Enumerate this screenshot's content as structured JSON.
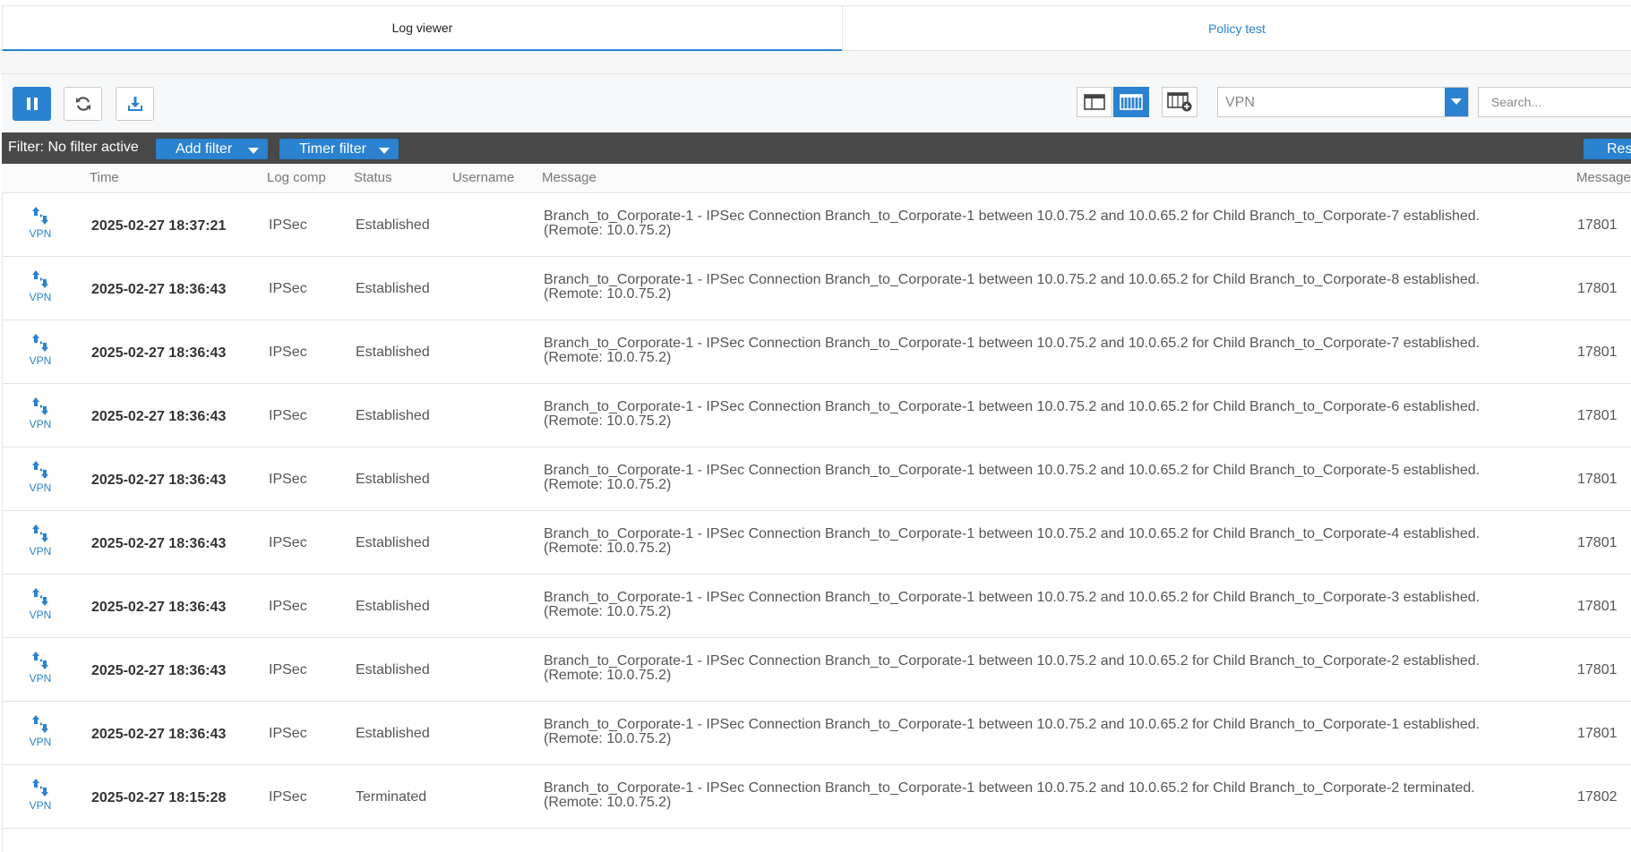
{
  "tabs": [
    {
      "label": "Log viewer",
      "active": true
    },
    {
      "label": "Policy test",
      "active": false
    }
  ],
  "toolbar": {
    "pause_icon": "pause-icon",
    "refresh_icon": "refresh-icon",
    "export_icon": "download-icon",
    "module_select": {
      "value": "VPN"
    },
    "search": {
      "placeholder": "Search..."
    }
  },
  "filterbar": {
    "label": "Filter: No filter active",
    "add_filter": "Add filter",
    "timer_filter": "Timer filter",
    "reset": "Res"
  },
  "columns": [
    "Time",
    "Log comp",
    "Status",
    "Username",
    "Message",
    "Message"
  ],
  "rows": [
    {
      "icon_label": "VPN",
      "time": "2025-02-27 18:37:21",
      "comp": "IPSec",
      "status": "Established",
      "username": "",
      "msg1": "Branch_to_Corporate-1 - IPSec Connection Branch_to_Corporate-1 between 10.0.75.2 and 10.0.65.2 for Child Branch_to_Corporate-7 established.",
      "msg2": "(Remote: 10.0.75.2)",
      "msgid": "17801"
    },
    {
      "icon_label": "VPN",
      "time": "2025-02-27 18:36:43",
      "comp": "IPSec",
      "status": "Established",
      "username": "",
      "msg1": "Branch_to_Corporate-1 - IPSec Connection Branch_to_Corporate-1 between 10.0.75.2 and 10.0.65.2 for Child Branch_to_Corporate-8 established.",
      "msg2": "(Remote: 10.0.75.2)",
      "msgid": "17801"
    },
    {
      "icon_label": "VPN",
      "time": "2025-02-27 18:36:43",
      "comp": "IPSec",
      "status": "Established",
      "username": "",
      "msg1": "Branch_to_Corporate-1 - IPSec Connection Branch_to_Corporate-1 between 10.0.75.2 and 10.0.65.2 for Child Branch_to_Corporate-7 established.",
      "msg2": "(Remote: 10.0.75.2)",
      "msgid": "17801"
    },
    {
      "icon_label": "VPN",
      "time": "2025-02-27 18:36:43",
      "comp": "IPSec",
      "status": "Established",
      "username": "",
      "msg1": "Branch_to_Corporate-1 - IPSec Connection Branch_to_Corporate-1 between 10.0.75.2 and 10.0.65.2 for Child Branch_to_Corporate-6 established.",
      "msg2": "(Remote: 10.0.75.2)",
      "msgid": "17801"
    },
    {
      "icon_label": "VPN",
      "time": "2025-02-27 18:36:43",
      "comp": "IPSec",
      "status": "Established",
      "username": "",
      "msg1": "Branch_to_Corporate-1 - IPSec Connection Branch_to_Corporate-1 between 10.0.75.2 and 10.0.65.2 for Child Branch_to_Corporate-5 established.",
      "msg2": "(Remote: 10.0.75.2)",
      "msgid": "17801"
    },
    {
      "icon_label": "VPN",
      "time": "2025-02-27 18:36:43",
      "comp": "IPSec",
      "status": "Established",
      "username": "",
      "msg1": "Branch_to_Corporate-1 - IPSec Connection Branch_to_Corporate-1 between 10.0.75.2 and 10.0.65.2 for Child Branch_to_Corporate-4 established.",
      "msg2": "(Remote: 10.0.75.2)",
      "msgid": "17801"
    },
    {
      "icon_label": "VPN",
      "time": "2025-02-27 18:36:43",
      "comp": "IPSec",
      "status": "Established",
      "username": "",
      "msg1": "Branch_to_Corporate-1 - IPSec Connection Branch_to_Corporate-1 between 10.0.75.2 and 10.0.65.2 for Child Branch_to_Corporate-3 established.",
      "msg2": "(Remote: 10.0.75.2)",
      "msgid": "17801"
    },
    {
      "icon_label": "VPN",
      "time": "2025-02-27 18:36:43",
      "comp": "IPSec",
      "status": "Established",
      "username": "",
      "msg1": "Branch_to_Corporate-1 - IPSec Connection Branch_to_Corporate-1 between 10.0.75.2 and 10.0.65.2 for Child Branch_to_Corporate-2 established.",
      "msg2": "(Remote: 10.0.75.2)",
      "msgid": "17801"
    },
    {
      "icon_label": "VPN",
      "time": "2025-02-27 18:36:43",
      "comp": "IPSec",
      "status": "Established",
      "username": "",
      "msg1": "Branch_to_Corporate-1 - IPSec Connection Branch_to_Corporate-1 between 10.0.75.2 and 10.0.65.2 for Child Branch_to_Corporate-1 established.",
      "msg2": "(Remote: 10.0.75.2)",
      "msgid": "17801"
    },
    {
      "icon_label": "VPN",
      "time": "2025-02-27 18:15:28",
      "comp": "IPSec",
      "status": "Terminated",
      "username": "",
      "msg1": "Branch_to_Corporate-1 - IPSec Connection Branch_to_Corporate-1 between 10.0.75.2 and 10.0.65.2 for Child Branch_to_Corporate-2 terminated.",
      "msg2": "(Remote: 10.0.75.2)",
      "msgid": "17802"
    }
  ],
  "colors": {
    "accent": "#2a82d0",
    "filterbar": "#484848"
  }
}
